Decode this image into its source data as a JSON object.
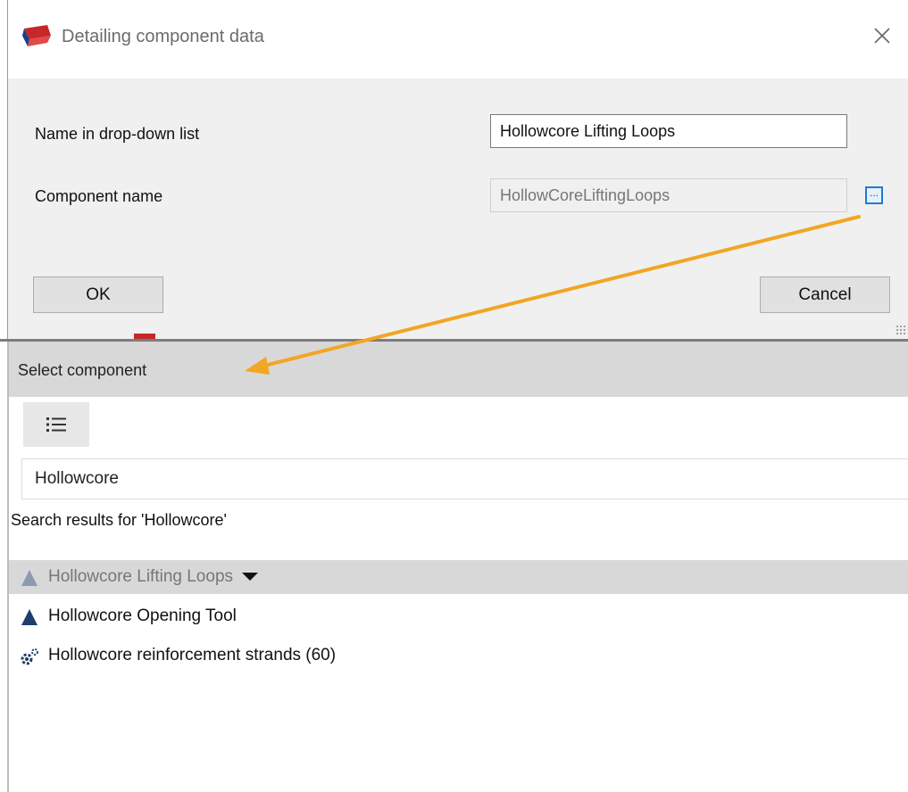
{
  "dialog": {
    "title": "Detailing component data",
    "name_label": "Name in drop-down list",
    "name_value": "Hollowcore Lifting Loops",
    "component_label": "Component name",
    "component_value": "HollowCoreLiftingLoops",
    "browse_label": "...",
    "ok_label": "OK",
    "cancel_label": "Cancel"
  },
  "panel": {
    "title": "Select component",
    "search_value": "Hollowcore",
    "results_label": "Search results for 'Hollowcore'",
    "results": [
      {
        "label": "Hollowcore Lifting Loops",
        "icon": "component-triangle-icon",
        "selected": true
      },
      {
        "label": "Hollowcore Opening Tool",
        "icon": "component-triangle-icon",
        "selected": false
      },
      {
        "label": "Hollowcore reinforcement strands (60)",
        "icon": "plugin-gear-icon",
        "selected": false
      }
    ]
  },
  "colors": {
    "arrow": "#f2a623",
    "accent_blue": "#1e7ad6",
    "header_gray": "#d8d8d8",
    "dialog_bg": "#f0f0f0"
  }
}
